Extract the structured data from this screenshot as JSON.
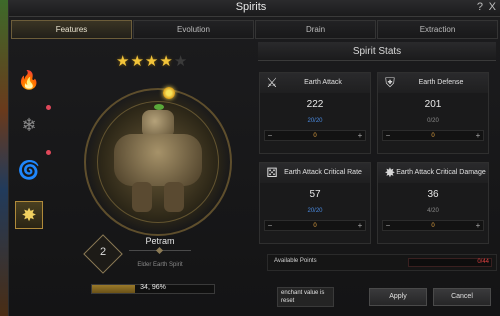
{
  "window": {
    "title": "Spirits",
    "help_label": "?",
    "close_label": "X"
  },
  "tabs": [
    {
      "label": "Features",
      "active": true
    },
    {
      "label": "Evolution",
      "active": false
    },
    {
      "label": "Drain",
      "active": false
    },
    {
      "label": "Extraction",
      "active": false
    }
  ],
  "sidebar": {
    "items": [
      {
        "icon": "fire-icon",
        "glyph": "🔥",
        "badge": false,
        "active": false
      },
      {
        "icon": "snowflake-icon",
        "glyph": "❄",
        "badge": true,
        "active": false
      },
      {
        "icon": "wind-icon",
        "glyph": "🌀",
        "badge": true,
        "active": false
      },
      {
        "icon": "earth-icon",
        "glyph": "✸",
        "badge": false,
        "active": true
      }
    ]
  },
  "spirit": {
    "stars": 4,
    "max_stars": 5,
    "level": "2",
    "name": "Petram",
    "subtitle": "Elder Earth Spirit",
    "progress_label": "34, 96%",
    "progress": 0.3496
  },
  "stats": {
    "title": "Spirit Stats",
    "cards": [
      {
        "label": "Earth Attack",
        "icon": "crossed-swords-icon",
        "glyph": "⚔",
        "value": "222",
        "count": "20/20",
        "full": true,
        "enchant": "0"
      },
      {
        "label": "Earth Defense",
        "icon": "shield-icon",
        "glyph": "⛨",
        "value": "201",
        "count": "0/20",
        "full": false,
        "enchant": "0"
      },
      {
        "label": "Earth Attack Critical Rate",
        "icon": "dice-icon",
        "glyph": "⚄",
        "value": "57",
        "count": "20/20",
        "full": true,
        "enchant": "0"
      },
      {
        "label": "Earth Attack Critical Damage",
        "icon": "burst-icon",
        "glyph": "✸",
        "value": "36",
        "count": "4/20",
        "full": false,
        "enchant": "0"
      }
    ]
  },
  "available": {
    "label": "Available Points",
    "value": "0/44"
  },
  "footer": {
    "reset_note": "enchant value is reset",
    "apply_label": "Apply",
    "cancel_label": "Cancel"
  },
  "colors": {
    "accent": "#f2c43a",
    "points_red": "#e04040",
    "count_blue": "#4a8ae0"
  }
}
